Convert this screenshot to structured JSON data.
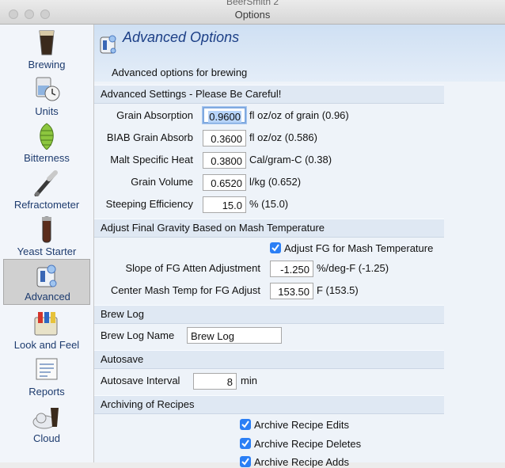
{
  "window": {
    "app_title": "BeerSmith 2",
    "title": "Options"
  },
  "sidebar": {
    "items": [
      {
        "label": "Brewing"
      },
      {
        "label": "Units"
      },
      {
        "label": "Bitterness"
      },
      {
        "label": "Refractometer"
      },
      {
        "label": "Yeast Starter"
      },
      {
        "label": "Advanced",
        "selected": true
      },
      {
        "label": "Look and Feel"
      },
      {
        "label": "Reports"
      },
      {
        "label": "Cloud"
      }
    ]
  },
  "header": {
    "title": "Advanced Options",
    "subtitle": "Advanced options for brewing"
  },
  "sections": {
    "advanced_settings": {
      "title": "Advanced Settings - Please Be Careful!",
      "grain_absorption": {
        "label": "Grain Absorption",
        "value": "0.9600",
        "unit": "fl oz/oz of grain (0.96)"
      },
      "biab_grain_absorb": {
        "label": "BIAB Grain Absorb",
        "value": "0.3600",
        "unit": "fl oz/oz (0.586)"
      },
      "malt_specific_heat": {
        "label": "Malt Specific Heat",
        "value": "0.3800",
        "unit": "Cal/gram-C (0.38)"
      },
      "grain_volume": {
        "label": "Grain Volume",
        "value": "0.6520",
        "unit": "l/kg (0.652)"
      },
      "steeping_efficiency": {
        "label": "Steeping Efficiency",
        "value": "15.0",
        "unit": "% (15.0)"
      }
    },
    "final_gravity": {
      "title": "Adjust Final Gravity Based on Mash Temperature",
      "adjust_fg_checkbox": {
        "label": "Adjust FG for Mash Temperature",
        "checked": true
      },
      "slope": {
        "label": "Slope of FG Atten Adjustment",
        "value": "-1.250",
        "unit": "%/deg-F (-1.25)"
      },
      "center_temp": {
        "label": "Center Mash Temp for FG Adjust",
        "value": "153.50",
        "unit": "F (153.5)"
      }
    },
    "brew_log": {
      "title": "Brew Log",
      "name": {
        "label": "Brew Log Name",
        "value": "Brew Log"
      }
    },
    "autosave": {
      "title": "Autosave",
      "interval": {
        "label": "Autosave Interval",
        "value": "8",
        "unit": "min"
      }
    },
    "archiving": {
      "title": "Archiving of Recipes",
      "edits": {
        "label": "Archive Recipe Edits",
        "checked": true
      },
      "deletes": {
        "label": "Archive Recipe Deletes",
        "checked": true
      },
      "adds": {
        "label": "Archive Recipe Adds",
        "checked": true
      }
    }
  },
  "colors": {
    "accent_checkbox": "#2b7ff5",
    "header_title": "#1c3f86",
    "sidebar_label": "#1d3b6e",
    "focus_ring": "#7fa9e0"
  },
  "icons": [
    "beer-glass-icon",
    "units-beaker-clock-icon",
    "hop-cone-icon",
    "refractometer-icon",
    "yeast-vial-icon",
    "advanced-options-icon",
    "palette-icon",
    "report-icon",
    "cloud-icon"
  ]
}
